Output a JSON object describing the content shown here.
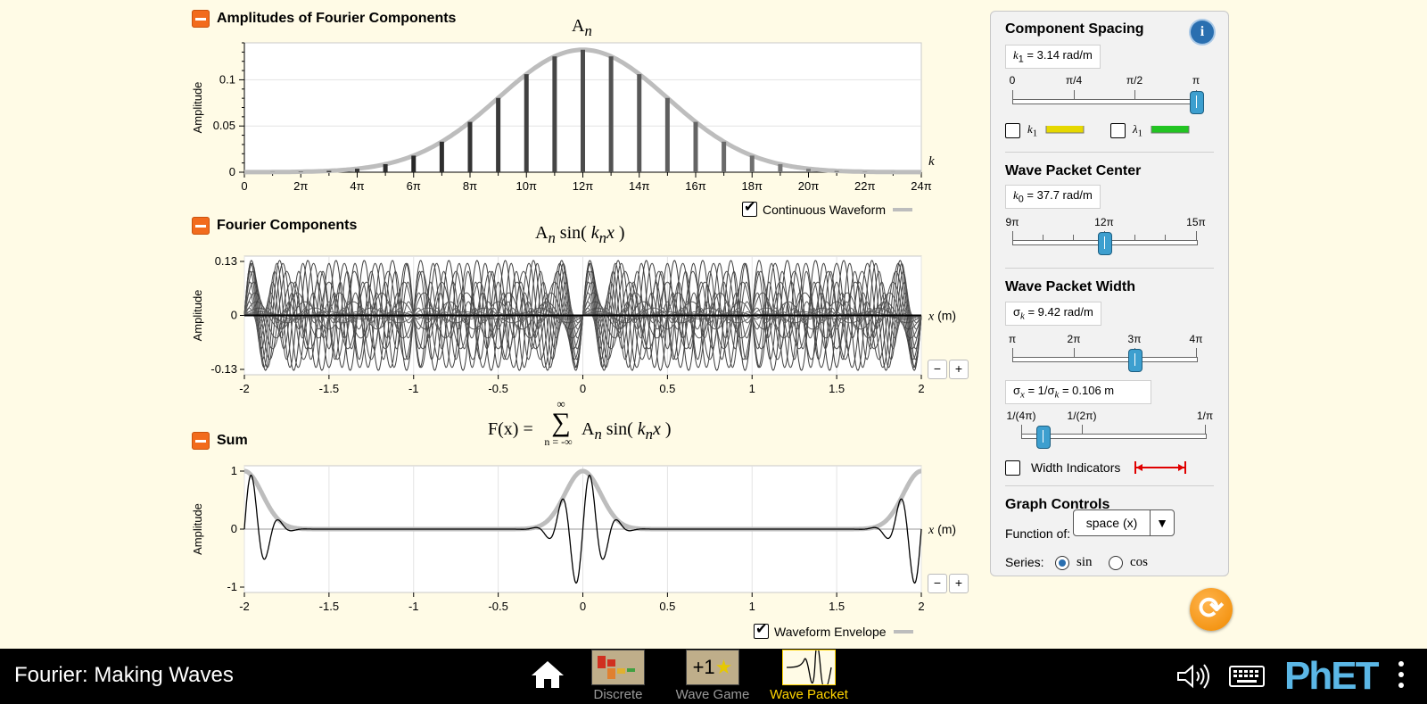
{
  "sections": {
    "amplitudes": {
      "title": "Amplitudes of Fourier Components",
      "equation_base": "A",
      "equation_sub": "n",
      "ylabel": "Amplitude",
      "xvar": "k",
      "yticks": [
        "0.1",
        "0.05",
        "0"
      ],
      "xticks": [
        "0",
        "2π",
        "4π",
        "6π",
        "8π",
        "10π",
        "12π",
        "14π",
        "16π",
        "18π",
        "20π",
        "22π",
        "24π"
      ],
      "continuous_waveform_label": "Continuous Waveform",
      "continuous_waveform_checked": true
    },
    "components": {
      "title": "Fourier Components",
      "equation": [
        "A",
        "n",
        " sin( ",
        "k",
        "n",
        "x",
        " )"
      ],
      "ylabel": "Amplitude",
      "yticks": [
        "0.13",
        "0",
        "-0.13"
      ],
      "xticks": [
        "-2",
        "-1.5",
        "-1",
        "-0.5",
        "0",
        "0.5",
        "1",
        "1.5",
        "2"
      ],
      "xaxis_var": "x",
      "xaxis_unit": "(m)",
      "zoom_out": "−",
      "zoom_in": "+"
    },
    "sum": {
      "title": "Sum",
      "equation_lhs": "F(x) =",
      "sum_top": "∞",
      "sum_bottom": "n = -∞",
      "sum_symbol": "∑",
      "equation_rhs": [
        "A",
        "n",
        " sin( ",
        "k",
        "n",
        "x",
        " )"
      ],
      "ylabel": "Amplitude",
      "yticks": [
        "1",
        "0",
        "-1"
      ],
      "xticks": [
        "-2",
        "-1.5",
        "-1",
        "-0.5",
        "0",
        "0.5",
        "1",
        "1.5",
        "2"
      ],
      "xaxis_var": "x",
      "xaxis_unit": "(m)",
      "zoom_out": "−",
      "zoom_in": "+",
      "envelope_label": "Waveform Envelope",
      "envelope_checked": true
    }
  },
  "panel": {
    "component_spacing": {
      "title": "Component Spacing",
      "readout_var": "k",
      "readout_sub": "1",
      "readout_value": " = 3.14 rad/m",
      "slider_labels": [
        "0",
        "π/4",
        "π/2",
        "π"
      ],
      "k1_label": "k",
      "k1_sub": "1",
      "lambda_label": "λ",
      "lambda_sub": "1",
      "k1_checked": false,
      "lambda_checked": false,
      "k1_color": "#e6d800",
      "lambda_color": "#22c422"
    },
    "center": {
      "title": "Wave Packet Center",
      "readout_var": "k",
      "readout_sub": "0",
      "readout_value": " = 37.7 rad/m",
      "slider_labels": [
        "9π",
        "12π",
        "15π"
      ]
    },
    "width": {
      "title": "Wave Packet Width",
      "readout_var": "σ",
      "readout_sub": "k",
      "readout_value": " = 9.42 rad/m",
      "slider_labels": [
        "π",
        "2π",
        "3π",
        "4π"
      ],
      "sigma_x_text": "σ",
      "sigma_x_sub": "x",
      "sigma_x_mid": " = 1/σ",
      "sigma_x_sub2": "k",
      "sigma_x_value": " = 0.106 m",
      "slider2_labels": [
        "1/(4π)",
        "1/(2π)",
        "1/π"
      ],
      "indicators_label": "Width Indicators",
      "indicators_checked": false,
      "indicator_color": "#e00000"
    },
    "graph_controls": {
      "title": "Graph Controls",
      "function_of_label": "Function of:",
      "function_of_value": "space (x)",
      "series_label": "Series:",
      "series_sin": "sin",
      "series_cos": "cos",
      "series_selected": "sin"
    }
  },
  "navbar": {
    "app_title": "Fourier: Making Waves",
    "screens": [
      "Discrete",
      "Wave Game",
      "Wave Packet"
    ],
    "active_screen": "Wave Packet",
    "wave_game_thumb_text": "+1",
    "logo": "PhET"
  }
}
